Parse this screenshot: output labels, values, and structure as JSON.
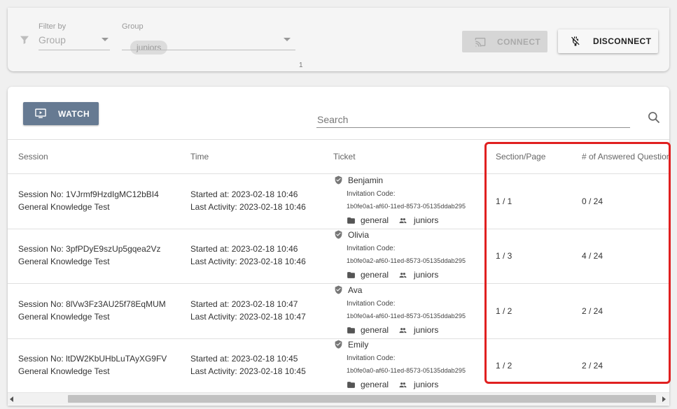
{
  "filters": {
    "filter_by_label": "Filter by",
    "filter_by_value": "Group",
    "group_label": "Group",
    "group_chip": "juniors",
    "group_count": "1"
  },
  "toolbar": {
    "connect_label": "CONNECT",
    "disconnect_label": "DISCONNECT"
  },
  "main": {
    "watch_label": "WATCH",
    "search_placeholder": "Search"
  },
  "table": {
    "columns": [
      "Session",
      "Time",
      "Ticket",
      "Section/Page",
      "# of Answered Questions"
    ],
    "rows": [
      {
        "session_no": "Session No: 1VJrmf9HzdIgMC12bBI4",
        "session_name": "General Knowledge Test",
        "started": "Started at: 2023-02-18 10:46",
        "last_activity": "Last Activity: 2023-02-18 10:46",
        "ticket_name": "Benjamin",
        "invitation_label": "Invitation Code:",
        "invitation_code": "1b0fe0a1-af60-11ed-8573-05135ddab295",
        "folder": "general",
        "group": "juniors",
        "section_page": "1 / 1",
        "answered": "0 / 24"
      },
      {
        "session_no": "Session No: 3pfPDyE9szUp5gqea2Vz",
        "session_name": "General Knowledge Test",
        "started": "Started at: 2023-02-18 10:46",
        "last_activity": "Last Activity: 2023-02-18 10:46",
        "ticket_name": "Olivia",
        "invitation_label": "Invitation Code:",
        "invitation_code": "1b0fe0a2-af60-11ed-8573-05135ddab295",
        "folder": "general",
        "group": "juniors",
        "section_page": "1 / 3",
        "answered": "4 / 24"
      },
      {
        "session_no": "Session No: 8lVw3Fz3AU25f78EqMUM",
        "session_name": "General Knowledge Test",
        "started": "Started at: 2023-02-18 10:47",
        "last_activity": "Last Activity: 2023-02-18 10:47",
        "ticket_name": "Ava",
        "invitation_label": "Invitation Code:",
        "invitation_code": "1b0fe0a4-af60-11ed-8573-05135ddab295",
        "folder": "general",
        "group": "juniors",
        "section_page": "1 / 2",
        "answered": "2 / 24"
      },
      {
        "session_no": "Session No: ltDW2KbUHbLuTAyXG9FV",
        "session_name": "General Knowledge Test",
        "started": "Started at: 2023-02-18 10:45",
        "last_activity": "Last Activity: 2023-02-18 10:45",
        "ticket_name": "Emily",
        "invitation_label": "Invitation Code:",
        "invitation_code": "1b0fe0a0-af60-11ed-8573-05135ddab295",
        "folder": "general",
        "group": "juniors",
        "section_page": "1 / 2",
        "answered": "2 / 24"
      }
    ]
  },
  "icons": {
    "filter": "filter-icon",
    "cast": "cast-icon",
    "unplug": "power-off-icon",
    "watch": "monitor-play-icon",
    "search": "search-icon",
    "ticket": "verified-shield-icon",
    "folder": "folder-icon",
    "group": "people-icon"
  },
  "colors": {
    "watch_button": "#667a92",
    "highlight": "#e02020"
  }
}
